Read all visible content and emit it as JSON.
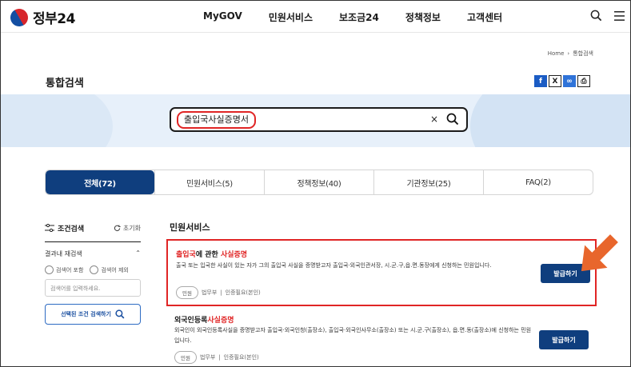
{
  "header": {
    "logo_text": "정부24",
    "nav": [
      "MyGOV",
      "민원서비스",
      "보조금24",
      "정책정보",
      "고객센터"
    ],
    "icons": [
      "search-icon",
      "hamburger-menu-icon"
    ]
  },
  "breadcrumb": {
    "home": "Home",
    "current": "통합검색"
  },
  "page_title": "통합검색",
  "share_icons": [
    "facebook-icon",
    "x-icon",
    "link-icon",
    "print-icon"
  ],
  "search": {
    "value": "출입국사실증명서",
    "clear": "×"
  },
  "tabs": [
    {
      "label": "전체(72)",
      "active": true
    },
    {
      "label": "민원서비스(5)"
    },
    {
      "label": "정책정보(40)"
    },
    {
      "label": "기관정보(25)"
    },
    {
      "label": "FAQ(2)"
    }
  ],
  "filter": {
    "title": "조건검색",
    "reset": "초기화",
    "sub_title": "결과내 재검색",
    "include": "검색어 포함",
    "exclude": "검색어 제외",
    "placeholder": "검색어를 입력하세요.",
    "button": "선택된 조건 검색하기"
  },
  "results": {
    "section_title": "민원서비스",
    "items": [
      {
        "title_pre_red": "출입국",
        "title_mid": "에 관한 ",
        "title_post_red": "사실증명",
        "desc": "출국 또는 입국한 사실이 있는 자가 그의 출입국 사실을 증명받고자 출입국·외국인관서장, 시.군.구,읍.면.동장에게 신청하는 민원입니다.",
        "chip": "민원",
        "agency": "법무부",
        "auth": "인증필요(본인)",
        "button": "발급하기"
      },
      {
        "title_pre": "외국인등록",
        "title_red": "사실증명",
        "desc": "외국인이 외국인등록사실을 증명받고자 출입국·외국인청(출장소), 출입국·외국인사무소(출장소) 또는 시.군.구(출장소), 읍.면.동(출장소)에 신청하는 민원입니다.",
        "chip": "민원",
        "agency": "법무부",
        "auth": "인증필요(본인)",
        "button": "발급하기"
      }
    ]
  },
  "colors": {
    "navy": "#0f3e7e",
    "highlight_red": "#e02525",
    "arrow_orange": "#e8662c",
    "band": "#e7f0fa"
  }
}
